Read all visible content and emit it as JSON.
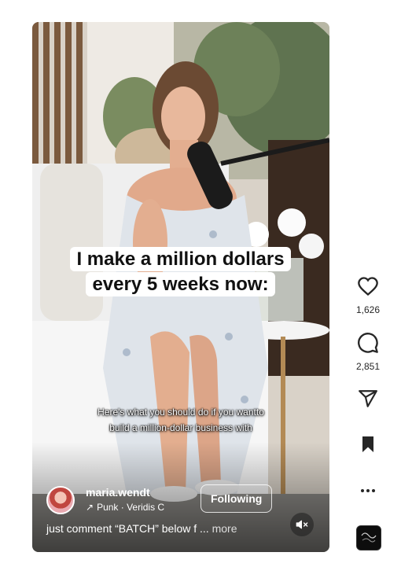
{
  "reel": {
    "headline": "I make a million dollars every 5 weeks now:",
    "caption_line1": "Here's what you should do if you wantto",
    "caption_line2": "build a million-dollar business with"
  },
  "author": {
    "username": "maria.wendt",
    "audio": "Punk · Veridis C",
    "follow_label": "Following"
  },
  "description": {
    "text": "just comment “BATCH” below f ...",
    "more_label": "more"
  },
  "actions": {
    "likes": "1,626",
    "comments": "2,851"
  },
  "icons": {
    "like": "heart-icon",
    "comment": "comment-icon",
    "share": "send-icon",
    "save": "bookmark-icon",
    "more": "more-icon",
    "mute": "speaker-muted-icon",
    "audio_arrow": "arrow-up-right-icon"
  }
}
